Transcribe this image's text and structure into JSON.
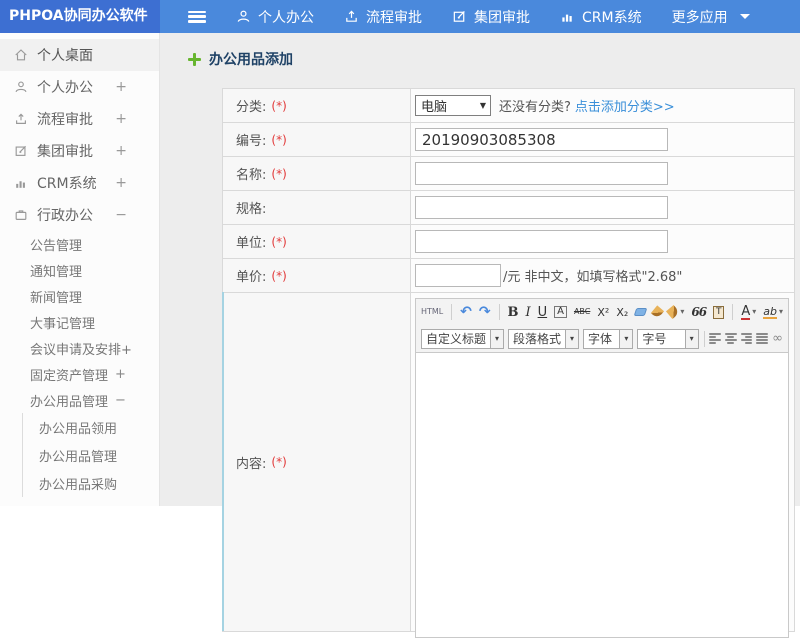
{
  "colors": {
    "header_logo_bg": "#3d6fd2",
    "header_nav_bg": "#4a89dc",
    "link_blue": "#3a8fd9",
    "required_red": "#e23b3b",
    "title_navy": "#1f4266",
    "plus_green": "#67b52f",
    "content_row_border": "#a5d3e2"
  },
  "header": {
    "logo_text": "PHPOA协同办公软件",
    "nav": [
      {
        "label": "个人办公",
        "icon": "user-icon"
      },
      {
        "label": "流程审批",
        "icon": "upload-icon"
      },
      {
        "label": "集团审批",
        "icon": "edit-icon"
      },
      {
        "label": "CRM系统",
        "icon": "chart-icon"
      },
      {
        "label": "更多应用",
        "icon": "caret-down-icon"
      }
    ]
  },
  "sidebar": {
    "items": [
      {
        "label": "个人桌面",
        "expand": "",
        "icon": "home-icon",
        "active": true
      },
      {
        "label": "个人办公",
        "expand": "+",
        "icon": "user-icon"
      },
      {
        "label": "流程审批",
        "expand": "+",
        "icon": "upload-icon"
      },
      {
        "label": "集团审批",
        "expand": "+",
        "icon": "edit-icon"
      },
      {
        "label": "CRM系统",
        "expand": "+",
        "icon": "chart-icon"
      },
      {
        "label": "行政办公",
        "expand": "−",
        "icon": "briefcase-icon"
      }
    ],
    "admin_items": [
      {
        "label": "公告管理",
        "expand": ""
      },
      {
        "label": "通知管理",
        "expand": ""
      },
      {
        "label": "新闻管理",
        "expand": ""
      },
      {
        "label": "大事记管理",
        "expand": ""
      },
      {
        "label": "会议申请及安排+",
        "expand": ""
      },
      {
        "label": "固定资产管理",
        "expand": "+"
      },
      {
        "label": "办公用品管理",
        "expand": "−"
      }
    ],
    "supplies_items": [
      {
        "label": "办公用品领用"
      },
      {
        "label": "办公用品管理"
      },
      {
        "label": "办公用品采购"
      }
    ]
  },
  "main": {
    "page_title": "办公用品添加",
    "form": {
      "rows": [
        {
          "label": "分类:",
          "required": "(*)"
        },
        {
          "label": "编号:",
          "required": "(*)"
        },
        {
          "label": "名称:",
          "required": "(*)"
        },
        {
          "label": "规格:",
          "required": ""
        },
        {
          "label": "单位:",
          "required": "(*)"
        },
        {
          "label": "单价:",
          "required": "(*)"
        },
        {
          "label": "内容:",
          "required": "(*)"
        }
      ],
      "category": {
        "selected": "电脑",
        "dropdown_arrow": "▼",
        "hint": "还没有分类?",
        "link": "点击添加分类>>"
      },
      "code_value": "20190903085308",
      "price_hint": "/元 非中文，如填写格式\"2.68\""
    },
    "editor": {
      "html_button": "HTML",
      "icons": {
        "undo": "↶",
        "redo": "↷",
        "link": "∞",
        "caret": "▾"
      },
      "bold": "B",
      "italic": "I",
      "underline": "U",
      "font_box": "A",
      "strike": "ABC",
      "superscript": "X²",
      "subscript": "X₂",
      "quote": "66",
      "paste_letter": "T",
      "font_color": "A",
      "highlight": "ab",
      "selects": [
        {
          "label": "自定义标题"
        },
        {
          "label": "段落格式"
        },
        {
          "label": "字体"
        },
        {
          "label": "字号"
        }
      ]
    }
  }
}
